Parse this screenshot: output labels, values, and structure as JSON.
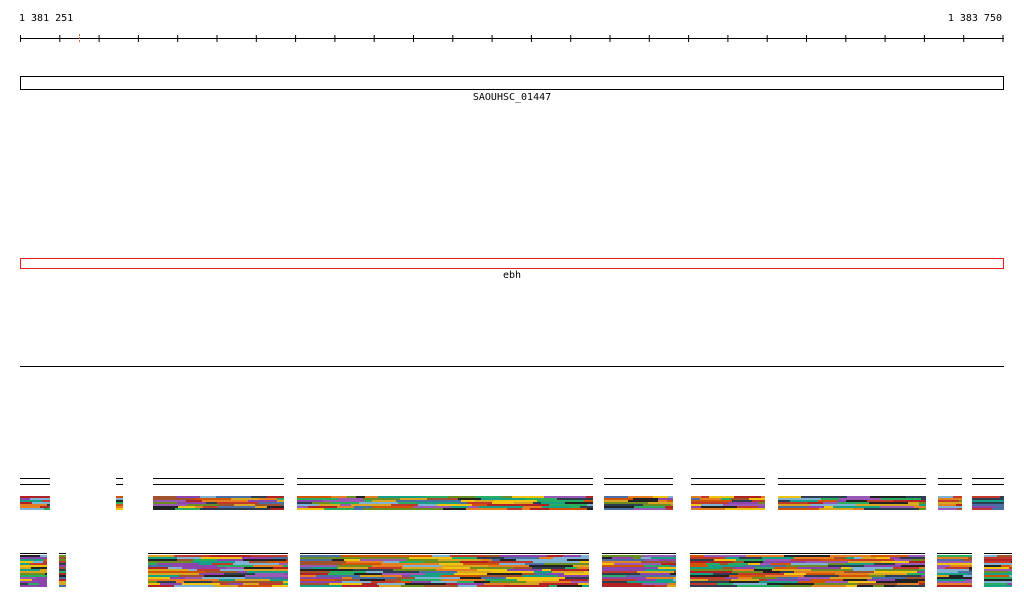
{
  "ruler": {
    "start_label": "1 381 251",
    "end_label": "1 383 750"
  },
  "genes": [
    {
      "name": "SAOUHSC_01447",
      "color": "#000000"
    },
    {
      "name": "ebh",
      "color": "#e02020"
    }
  ],
  "track_palette": [
    "#222222",
    "#4a6fa5",
    "#7fb3d5",
    "#c0392b",
    "#e67e22",
    "#27ae60",
    "#8e44ad",
    "#f1c40f",
    "#16a085",
    "#d35400",
    "#9b59b6",
    "#2c3e50",
    "#a0522d",
    "#6b8e23",
    "#b22222",
    "#daa520"
  ]
}
